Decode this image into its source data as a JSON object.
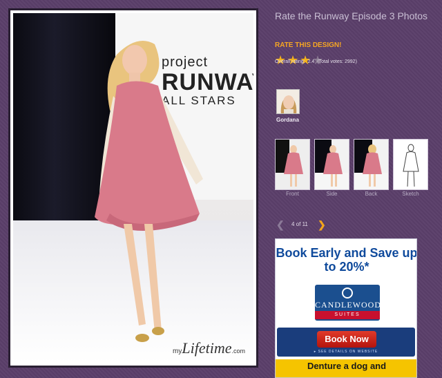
{
  "gallery": {
    "title": "Rate the Runway Episode 3 Photos",
    "rate_label": "RATE THIS DESIGN!",
    "rating": {
      "overall_label": "Overall rating:",
      "overall_value": "2.4",
      "votes_text": "(Total votes: 2992)",
      "filled_stars": 3,
      "total_stars": 4
    },
    "designer": {
      "name": "Gordana"
    },
    "thumbnails": [
      {
        "label": "Front"
      },
      {
        "label": "Side"
      },
      {
        "label": "Back"
      },
      {
        "label": "Sketch"
      }
    ],
    "pager": {
      "text": "4 of 11"
    }
  },
  "photo": {
    "backdrop_lines": [
      "project",
      "RUNWAY",
      "ALL STARS"
    ],
    "watermark": {
      "prefix": "my",
      "brand": "Lifetime",
      "suffix": ".com"
    }
  },
  "ad": {
    "headline": "Book Early and Save up to 20%*",
    "brand": "CANDLEWOOD",
    "brand_sub": "SUITES",
    "button": "Book Now",
    "details": "▸ SEE DETAILS ON WEBSITE",
    "bottom_text": "Denture a dog and"
  },
  "colors": {
    "page_bg": "#5b3f6a",
    "accent": "#f3a51c",
    "ad_blue": "#0f4a9c",
    "ad_red": "#c8102e"
  },
  "icons": [
    "star-icon",
    "prev-arrow-icon",
    "next-arrow-icon",
    "candlewood-emblem-icon"
  ]
}
